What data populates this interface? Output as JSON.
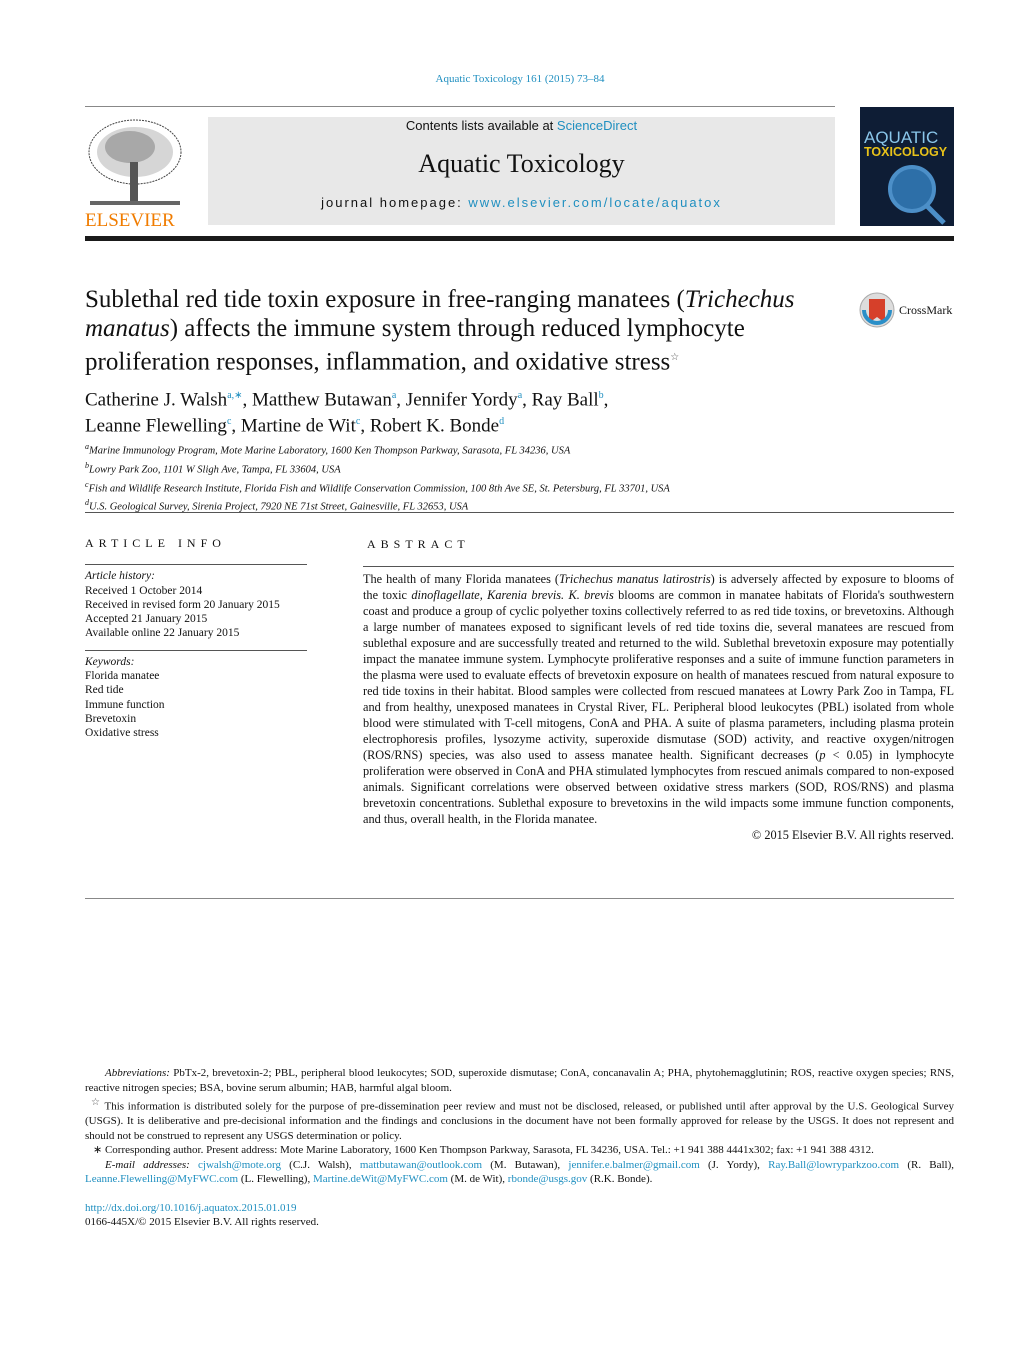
{
  "header": {
    "citation": "Aquatic Toxicology 161 (2015) 73–84",
    "contents_prefix": "Contents lists available at ",
    "contents_link": "ScienceDirect",
    "journal_name": "Aquatic Toxicology",
    "homepage_prefix": "journal homepage: ",
    "homepage_url": "www.elsevier.com/locate/aquatox",
    "publisher_logo": "ELSEVIER",
    "cover_title_1": "AQUATIC",
    "cover_title_2": "TOXICOLOGY"
  },
  "title": {
    "part1": "Sublethal red tide toxin exposure in free-ranging manatees (",
    "italic": "Trichechus manatus",
    "part2": ") affects the immune system through reduced lymphocyte proliferation responses, inflammation, and oxidative stress",
    "star": "☆"
  },
  "crossmark": "CrossMark",
  "authors": [
    {
      "name": "Catherine J. Walsh",
      "aff": "a,∗",
      "sep": ", "
    },
    {
      "name": "Matthew Butawan",
      "aff": "a",
      "sep": ", "
    },
    {
      "name": "Jennifer Yordy",
      "aff": "a",
      "sep": ", "
    },
    {
      "name": "Ray Ball",
      "aff": "b",
      "sep": ","
    },
    {
      "name": "Leanne Flewelling",
      "aff": "c",
      "sep": ", "
    },
    {
      "name": "Martine de Wit",
      "aff": "c",
      "sep": ", "
    },
    {
      "name": "Robert K. Bonde",
      "aff": "d",
      "sep": ""
    }
  ],
  "affiliations": [
    {
      "key": "a",
      "text": "Marine Immunology Program, Mote Marine Laboratory, 1600 Ken Thompson Parkway, Sarasota, FL 34236, USA"
    },
    {
      "key": "b",
      "text": "Lowry Park Zoo, 1101 W Sligh Ave, Tampa, FL 33604, USA"
    },
    {
      "key": "c",
      "text": "Fish and Wildlife Research Institute, Florida Fish and Wildlife Conservation Commission, 100 8th Ave SE, St. Petersburg, FL 33701, USA"
    },
    {
      "key": "d",
      "text": "U.S. Geological Survey, Sirenia Project, 7920 NE 71st Street, Gainesville, FL 32653, USA"
    }
  ],
  "article_info": {
    "heading": "ARTICLE INFO",
    "history_label": "Article history:",
    "history": [
      "Received 1 October 2014",
      "Received in revised form 20 January 2015",
      "Accepted 21 January 2015",
      "Available online 22 January 2015"
    ],
    "keywords_label": "Keywords:",
    "keywords": [
      "Florida manatee",
      "Red tide",
      "Immune function",
      "Brevetoxin",
      "Oxidative stress"
    ]
  },
  "abstract": {
    "heading": "ABSTRACT",
    "segments": [
      {
        "t": "The health of many Florida manatees ("
      },
      {
        "t": "Trichechus manatus latirostris",
        "i": true
      },
      {
        "t": ") is adversely affected by exposure to blooms of the toxic "
      },
      {
        "t": "dinoflagellate, Karenia brevis. K. brevis",
        "i": true
      },
      {
        "t": " blooms are common in manatee habitats of Florida's southwestern coast and produce a group of cyclic polyether toxins collectively referred to as red tide toxins, or brevetoxins. Although a large number of manatees exposed to significant levels of red tide toxins die, several manatees are rescued from sublethal exposure and are successfully treated and returned to the wild. Sublethal brevetoxin exposure may potentially impact the manatee immune system. Lymphocyte proliferative responses and a suite of immune function parameters in the plasma were used to evaluate effects of brevetoxin exposure on health of manatees rescued from natural exposure to red tide toxins in their habitat. Blood samples were collected from rescued manatees at Lowry Park Zoo in Tampa, FL and from healthy, unexposed manatees in Crystal River, FL. Peripheral blood leukocytes (PBL) isolated from whole blood were stimulated with T-cell mitogens, ConA and PHA. A suite of plasma parameters, including plasma protein electrophoresis profiles, lysozyme activity, superoxide dismutase (SOD) activity, and reactive oxygen/nitrogen (ROS/RNS) species, was also used to assess manatee health. Significant decreases ("
      },
      {
        "t": "p",
        "i": true
      },
      {
        "t": " < 0.05) in lymphocyte proliferation were observed in ConA and PHA stimulated lymphocytes from rescued animals compared to non-exposed animals. Significant correlations were observed between oxidative stress markers (SOD, ROS/RNS) and plasma brevetoxin concentrations. Sublethal exposure to brevetoxins in the wild impacts some immune function components, and thus, overall health, in the Florida manatee."
      }
    ],
    "copyright": "© 2015 Elsevier B.V. All rights reserved."
  },
  "footnotes": {
    "abbrev_label": "Abbreviations:",
    "abbrev": "  PbTx-2, brevetoxin-2; PBL, peripheral blood leukocytes; SOD, superoxide dismutase; ConA, concanavalin A; PHA, phytohemagglutinin; ROS, reactive oxygen species; RNS, reactive nitrogen species; BSA, bovine serum albumin; HAB, harmful algal bloom.",
    "star": "☆",
    "star_text": " This information is distributed solely for the purpose of pre-dissemination peer review and must not be disclosed, released, or published until after approval by the U.S. Geological Survey (USGS). It is deliberative and pre-decisional information and the findings and conclusions in the document have not been formally approved for release by the USGS. It does not represent and should not be construed to represent any USGS determination or policy.",
    "corr": "∗ Corresponding author. Present address: Mote Marine Laboratory, 1600 Ken Thompson Parkway, Sarasota, FL 34236, USA. Tel.: +1 941 388 4441x302; fax: +1 941 388 4312.",
    "email_label": "E-mail addresses:",
    "emails": [
      {
        "email": "cjwalsh@mote.org",
        "who": " (C.J. Walsh), "
      },
      {
        "email": "mattbutawan@outlook.com",
        "who": " (M. Butawan), "
      },
      {
        "email": "jennifer.e.balmer@gmail.com",
        "who": " (J. Yordy), "
      },
      {
        "email": "Ray.Ball@lowryparkzoo.com",
        "who": " (R. Ball), "
      },
      {
        "email": "Leanne.Flewelling@MyFWC.com",
        "who": " (L. Flewelling), "
      },
      {
        "email": "Martine.deWit@MyFWC.com",
        "who": " (M. de Wit), "
      },
      {
        "email": "rbonde@usgs.gov",
        "who": " (R.K. Bonde)."
      }
    ],
    "doi": "http://dx.doi.org/10.1016/j.aquatox.2015.01.019",
    "issn": "0166-445X/© 2015 Elsevier B.V. All rights reserved."
  },
  "colors": {
    "link": "#1f8fc0",
    "elsevier_orange": "#f07c00"
  }
}
